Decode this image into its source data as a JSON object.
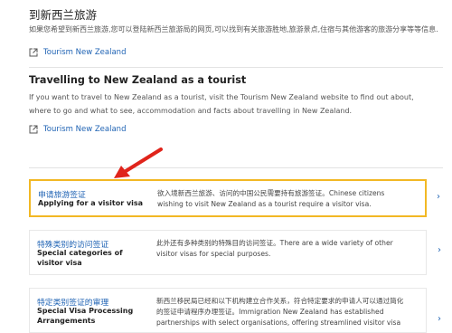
{
  "sections": {
    "cn": {
      "title": "到新西兰旅游",
      "body": "如果您希望到新西兰旅游,您可以登陆新西兰旅游局的网页,可以找到有关旅游胜地,旅游景点,住宿与其他游客的旅游分享等等信息.",
      "link": "Tourism New Zealand"
    },
    "en": {
      "title": "Travelling to New Zealand as a tourist",
      "body": "If you want to travel to New Zealand as a tourist, visit the Tourism New Zealand website to find out about, where to go and what to see, accommodation and facts about travelling in New Zealand.",
      "link": "Tourism New Zealand"
    }
  },
  "cards": [
    {
      "title_cn": "申请旅游签证",
      "title_en": "Applying for a visitor visa",
      "desc": "欲入境新西兰旅游、访问的中国公民需要持有旅游签证。Chinese citizens wishing to visit New Zealand as a tourist require a visitor visa."
    },
    {
      "title_cn": "特殊类别的访问签证",
      "title_en": "Special categories of visitor visa",
      "desc": "此外还有多种类别的特殊目的访问签证。There are a wide variety of other visitor visas for special purposes."
    },
    {
      "title_cn": "特定类别签证的审理",
      "title_en": "Special Visa Processing Arrangements",
      "desc": "新西兰移民局已经和以下机构建立合作关系，符合特定要求的申请人可以通过简化的签证申请程序办理签证。Immigration New Zealand has established partnerships with select organisations, offering streamlined visitor visa"
    }
  ],
  "icons": {
    "external": "external-link-icon",
    "chevron": "chevron-right-icon",
    "annotation": "red-arrow-annotation"
  },
  "colors": {
    "link": "#1f63b4",
    "highlight": "#f2b824",
    "arrow": "#e0241b"
  }
}
